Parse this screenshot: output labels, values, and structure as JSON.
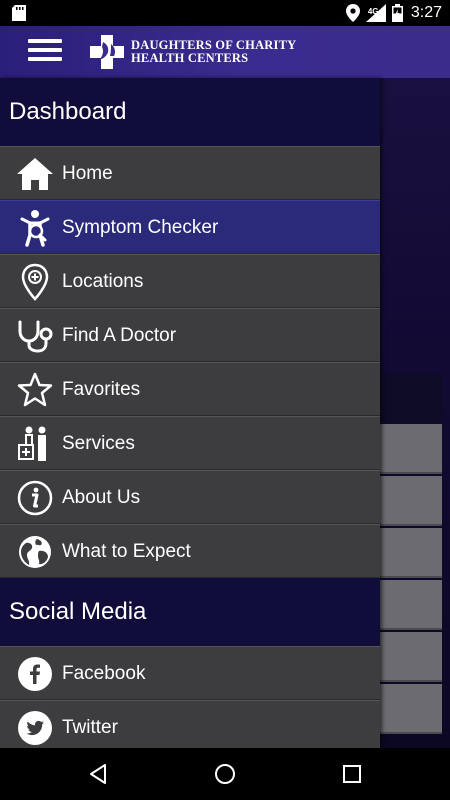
{
  "status_bar": {
    "network": "4G",
    "time": "3:27"
  },
  "header": {
    "logo_line1": "DAUGHTERS OF CHARITY",
    "logo_line2": "HEALTH CENTERS",
    "brand_color": "#2f2585"
  },
  "drawer": {
    "section_dashboard": "Dashboard",
    "dashboard_items": [
      {
        "label": "Home",
        "icon": "home-icon"
      },
      {
        "label": "Symptom Checker",
        "icon": "symptom-checker-icon"
      },
      {
        "label": "Locations",
        "icon": "location-pin-icon"
      },
      {
        "label": "Find A Doctor",
        "icon": "stethoscope-icon"
      },
      {
        "label": "Favorites",
        "icon": "star-icon"
      },
      {
        "label": "Services",
        "icon": "services-icon"
      },
      {
        "label": "About Us",
        "icon": "info-icon"
      },
      {
        "label": "What to Expect",
        "icon": "globe-icon"
      }
    ],
    "section_social": "Social Media",
    "social_items": [
      {
        "label": "Facebook",
        "icon": "facebook-icon"
      },
      {
        "label": "Twitter",
        "icon": "twitter-icon"
      }
    ],
    "active_item": "Symptom Checker",
    "active_color": "#2b2a7a"
  }
}
